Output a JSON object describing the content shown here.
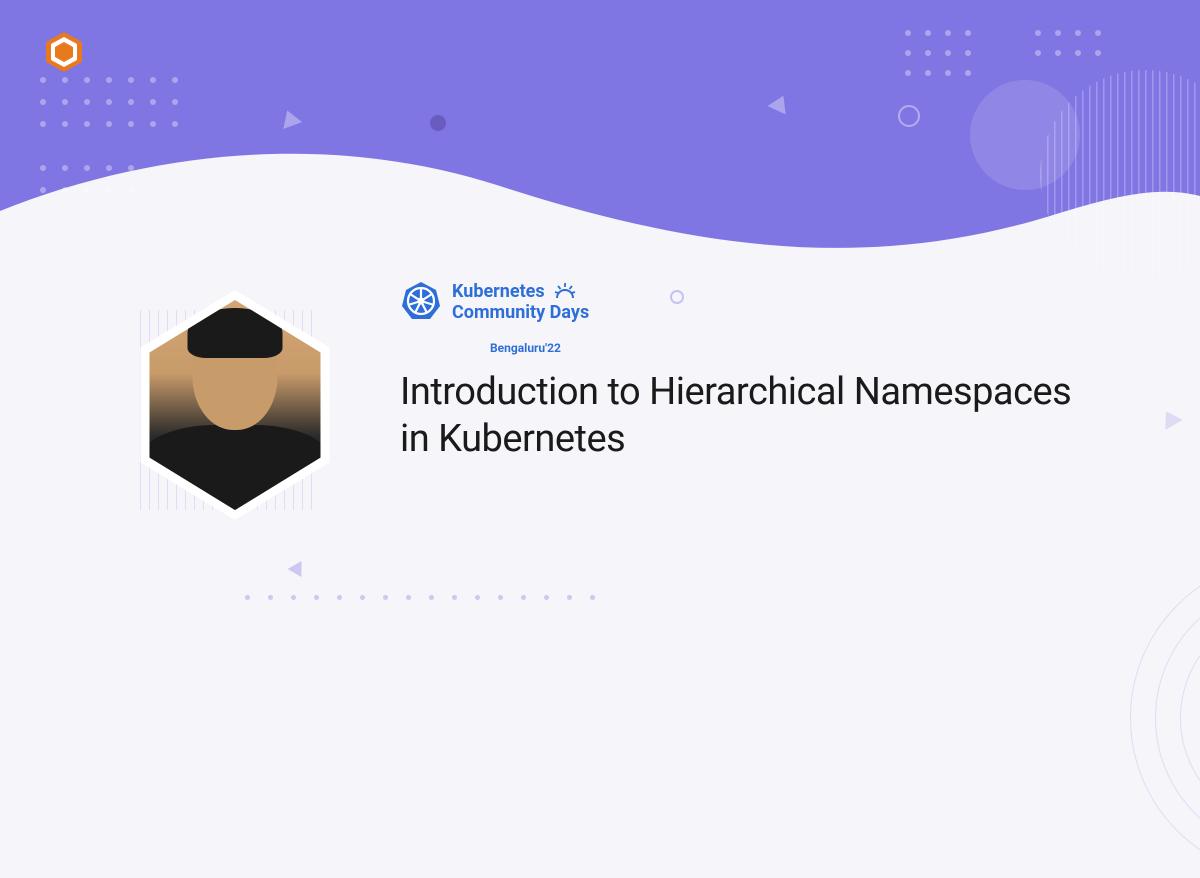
{
  "brand": {
    "logo_name": "konfhub-logo",
    "logo_color": "#e8791e"
  },
  "event": {
    "org_line1": "Kubernetes",
    "org_line2": "Community Days",
    "location": "Bengaluru'22"
  },
  "talk": {
    "title": "Introduction to Hierarchical Namespaces in Kubernetes"
  },
  "colors": {
    "primary": "#8076e3",
    "accent": "#2e6ed8",
    "text": "#1a1a1a"
  }
}
